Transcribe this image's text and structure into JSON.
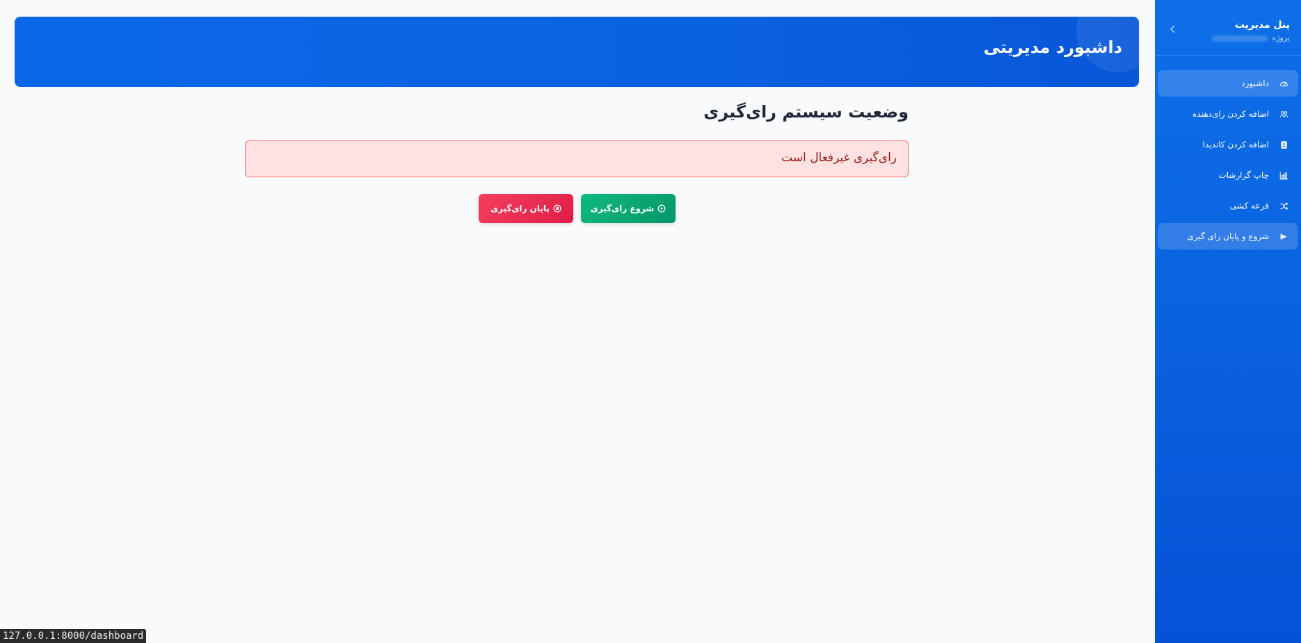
{
  "sidebar": {
    "title": "پنل مدیریت",
    "subtitle": "پروژه",
    "items": [
      {
        "label": "داشبورد",
        "icon": "gauge-icon",
        "active": true
      },
      {
        "label": "اضافه کردن رای‌دهنده",
        "icon": "users-icon",
        "active": false
      },
      {
        "label": "اضافه کردن کاندیدا",
        "icon": "id-card-icon",
        "active": false
      },
      {
        "label": "چاپ گزارشات",
        "icon": "bar-chart-icon",
        "active": false
      },
      {
        "label": "قرعه کشی",
        "icon": "shuffle-icon",
        "active": false
      },
      {
        "label": "شروع و پایان رای گیری",
        "icon": "flag-icon",
        "active": true
      }
    ]
  },
  "header": {
    "title": "داشبورد مدیریتی"
  },
  "main": {
    "title": "وضعیت سیستم رای‌گیری",
    "alert": "رای‌گیری غیرفعال است",
    "start_button": "شروع رای‌گیری",
    "end_button": "پایان رای‌گیری"
  },
  "statusbar": {
    "url": "127.0.0.1:8000/dashboard"
  },
  "colors": {
    "sidebar": "#0a62e0",
    "start": "#10b981",
    "end": "#e11d48",
    "alert_bg": "#fee2e2",
    "alert_border": "#f87171"
  }
}
